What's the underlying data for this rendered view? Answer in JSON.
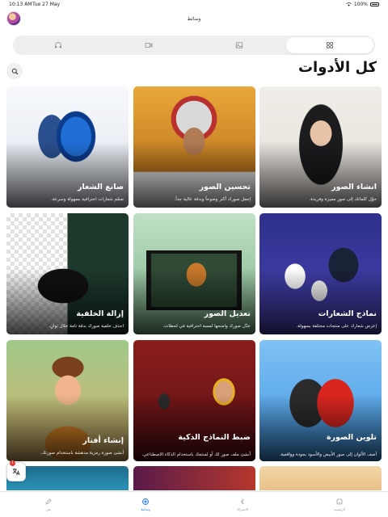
{
  "status_bar": {
    "time": "10:13 AM",
    "date": "Tue 27 May",
    "battery": "100%"
  },
  "app": {
    "title": "وسائط"
  },
  "tabs": [
    {
      "icon": "grid-icon",
      "active": true
    },
    {
      "icon": "image-icon",
      "active": false
    },
    {
      "icon": "video-icon",
      "active": false
    },
    {
      "icon": "headphones-icon",
      "active": false
    }
  ],
  "section": {
    "title": "كل الأدوات"
  },
  "tools": [
    {
      "title": "انشاء الصور",
      "description": "حوّل كلماتك إلى صور مميزة وفريدة."
    },
    {
      "title": "تحسين الصور",
      "description": "إجعل صورك أكثر وضوحاً وبدقة عالية جداً."
    },
    {
      "title": "صانع الشعار",
      "description": "صمّم شعارات احترافية بسهولة وسرعة."
    },
    {
      "title": "نماذج الشعارات",
      "description": "إعرض شعارك على منتجات مختلفة بسهولة."
    },
    {
      "title": "تعديل الصور",
      "description": "عدّل صورك وامنحها لمسة احترافية في لحظات."
    },
    {
      "title": "إزالة الخلفية",
      "description": "احذف خلفية صورك بدقة تامة خلال ثوانٍ."
    },
    {
      "title": "تلوين الصورة",
      "description": "أضف الألوان إلى صور الأبيض والأسود بجودة وواقعية."
    },
    {
      "title": "ضبط النماذج الذكية",
      "description": "أنشئ ملف صور لك أو لمنتجك باستخدام الذكاء الاصطناعي."
    },
    {
      "title": "إنشاء أفتار",
      "description": "أنشئ صورة رمزية مدهشة باستخدام صورتك."
    }
  ],
  "bottom_nav": [
    {
      "label": "الرئيسية",
      "icon": "home-icon",
      "active": false
    },
    {
      "label": "الاشتراك",
      "icon": "brand-logo-icon",
      "active": false
    },
    {
      "label": "وسائط",
      "icon": "media-icon",
      "active": true
    },
    {
      "label": "نص",
      "icon": "pencil-icon",
      "active": false
    }
  ],
  "floating_badge": {
    "count": "1"
  },
  "colors": {
    "accent": "#2a7de1",
    "tab_bg": "#eeeeef"
  }
}
